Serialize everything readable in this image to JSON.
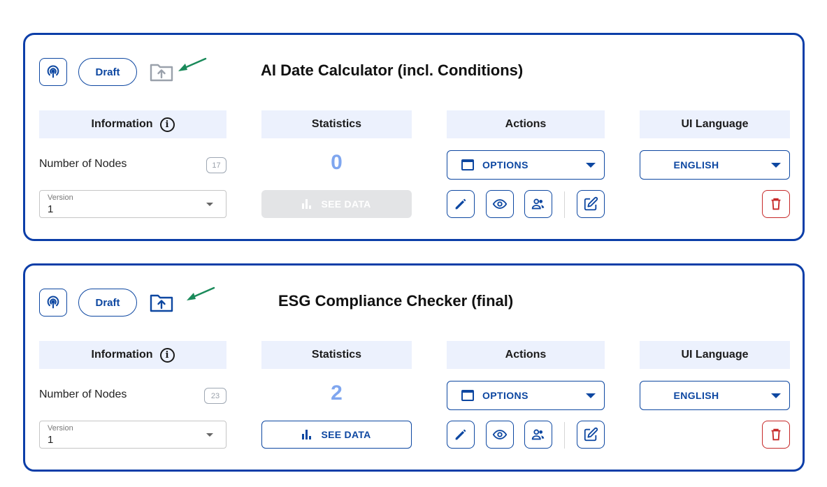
{
  "colors": {
    "primary": "#0d47a1",
    "card_border": "#0c3ea8",
    "header_bg": "#ecf1fd",
    "stat_value": "#7fa6ef",
    "danger": "#c62828",
    "annotation_arrow": "#1a8a5a",
    "upload_disabled": "#9aa1ab"
  },
  "columns": {
    "information": "Information",
    "statistics": "Statistics",
    "actions": "Actions",
    "ui_language": "UI Language"
  },
  "labels": {
    "draft": "Draft",
    "number_of_nodes": "Number of Nodes",
    "version": "Version",
    "options": "OPTIONS",
    "see_data": "SEE DATA",
    "info_glyph": "i"
  },
  "cards": [
    {
      "title": "AI Date Calculator (incl. Conditions)",
      "node_count": "17",
      "version": "1",
      "statistics": "0",
      "see_data_enabled": false,
      "upload_enabled": false,
      "language": "ENGLISH"
    },
    {
      "title": "ESG Compliance Checker (final)",
      "node_count": "23",
      "version": "1",
      "statistics": "2",
      "see_data_enabled": true,
      "upload_enabled": true,
      "language": "ENGLISH"
    }
  ],
  "icons": {
    "podcast": "podcast-icon",
    "upload_folder": "folder-upload-icon",
    "annotation_arrow": "annotation-arrow-icon",
    "info": "info-icon",
    "bars": "bar-chart-icon",
    "window": "window-icon",
    "edit": "pencil-icon",
    "view": "eye-icon",
    "users": "users-icon",
    "edit_square": "edit-square-icon",
    "delete": "trash-icon"
  }
}
